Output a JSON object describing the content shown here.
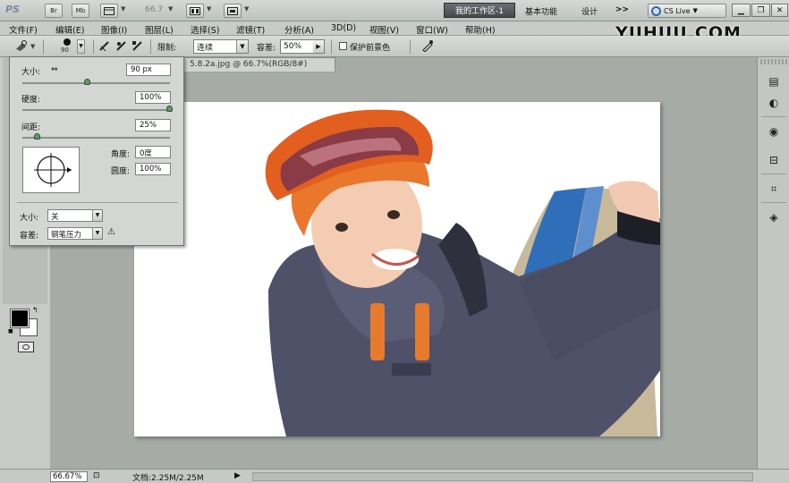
{
  "app": {
    "logo": "PS"
  },
  "appbar": {
    "bridge_label": "Br",
    "minibridge_label": "Mb",
    "zoom": "66.7",
    "workspace_active": "我的工作区-1",
    "workspace_items": [
      "基本功能",
      "设计"
    ],
    "more": ">>",
    "cs_live": "CS Live"
  },
  "menu": [
    "文件(F)",
    "编辑(E)",
    "图像(I)",
    "图层(L)",
    "选择(S)",
    "滤镜(T)",
    "分析(A)",
    "3D(D)",
    "视图(V)",
    "窗口(W)",
    "帮助(H)"
  ],
  "watermark": "YIIHUU.COM",
  "options": {
    "brush_size": "90",
    "limit_label": "限制:",
    "limit_value": "连续",
    "tolerance_label": "容差:",
    "tolerance_value": "50%",
    "protect_label": "保护前景色"
  },
  "document": {
    "tab_title": "5.8.2a.jpg @ 66.7%(RGB/8#)"
  },
  "brush_panel": {
    "size_label": "大小:",
    "size_value": "90 px",
    "hardness_label": "硬度:",
    "hardness_value": "100%",
    "spacing_label": "间距:",
    "spacing_value": "25%",
    "angle_label": "角度:",
    "angle_value": "0度",
    "roundness_label": "圆度:",
    "roundness_value": "100%",
    "size_control_label": "大小:",
    "size_control_value": "关",
    "tolerance_label": "容差:",
    "tolerance_value": "钢笔压力",
    "size_slider": 0.44,
    "hardness_slider": 1.0,
    "spacing_slider": 0.1
  },
  "status": {
    "zoom": "66.67%",
    "doc_info": "文档:2.25M/2.25M",
    "arrow": "▶"
  }
}
